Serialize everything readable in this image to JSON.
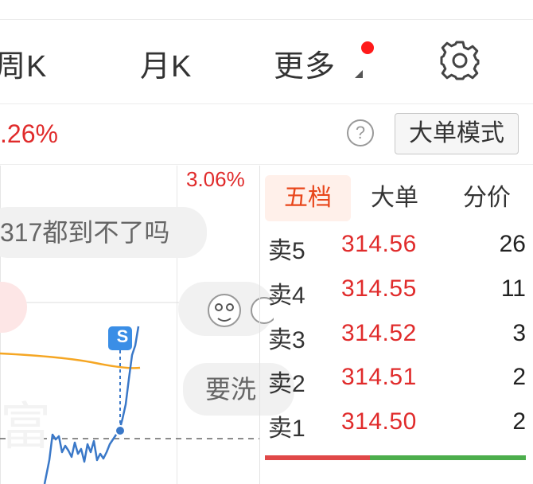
{
  "tabs": {
    "weekly": "周K",
    "monthly": "月K",
    "more": "更多"
  },
  "header": {
    "change_pct": ".26%",
    "mode_button": "大单模式",
    "help_symbol": "?"
  },
  "chart": {
    "change_pct": "3.06%",
    "comments": [
      "317都到不了吗",
      "要洗"
    ],
    "signal_badge": "S",
    "colors": {
      "price_line": "#3a78c8",
      "avg_line": "#f5a623",
      "up": "#e02b2b",
      "down": "#4cae4c"
    }
  },
  "order_book": {
    "tabs": [
      "五档",
      "大单",
      "分价"
    ],
    "active_tab": "五档",
    "asks": [
      {
        "label": "卖5",
        "price": "314.56",
        "volume": "26"
      },
      {
        "label": "卖4",
        "price": "314.55",
        "volume": "11"
      },
      {
        "label": "卖3",
        "price": "314.52",
        "volume": "3"
      },
      {
        "label": "卖2",
        "price": "314.51",
        "volume": "2"
      },
      {
        "label": "卖1",
        "price": "314.50",
        "volume": "2"
      }
    ]
  }
}
